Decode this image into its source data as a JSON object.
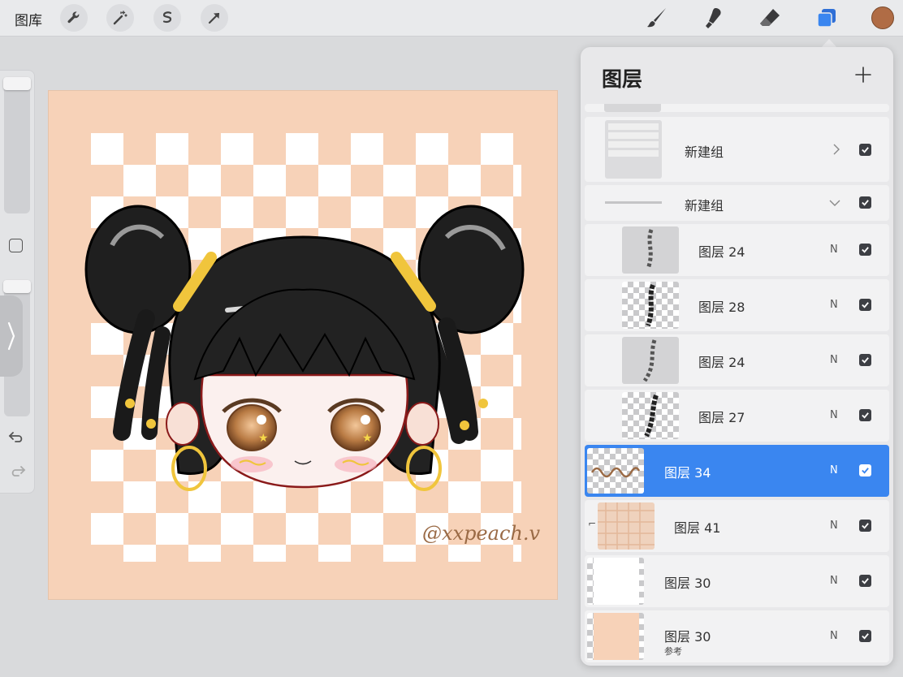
{
  "topbar": {
    "gallery_label": "图库",
    "tools_left": [
      "wrench-icon",
      "magic-wand-icon",
      "selection-icon",
      "transform-arrow-icon"
    ],
    "tools_right": [
      "brush-icon",
      "smudge-icon",
      "eraser-icon",
      "layers-icon"
    ],
    "current_color": "#b06c45",
    "accent": "#3a86f0"
  },
  "canvas": {
    "background_color": "#f7d2b8",
    "signature": "@xxpeach.v"
  },
  "layers_panel": {
    "title": "图层",
    "layers": [
      {
        "name": "新建组",
        "mode": "",
        "kind": "group-collapsed",
        "visible": true
      },
      {
        "name": "新建组",
        "mode": "",
        "kind": "group-expanded",
        "visible": true
      },
      {
        "name": "图层 24",
        "mode": "N",
        "kind": "braid",
        "visible": true
      },
      {
        "name": "图层 28",
        "mode": "N",
        "kind": "braid-dark",
        "visible": true
      },
      {
        "name": "图层 24",
        "mode": "N",
        "kind": "braid",
        "visible": true
      },
      {
        "name": "图层 27",
        "mode": "N",
        "kind": "braid-dark",
        "visible": true
      },
      {
        "name": "图层 34",
        "mode": "N",
        "kind": "signature",
        "visible": true,
        "selected": true
      },
      {
        "name": "图层 41",
        "mode": "N",
        "kind": "pattern",
        "visible": true,
        "clipped": true
      },
      {
        "name": "图层 30",
        "mode": "N",
        "kind": "white",
        "visible": true
      },
      {
        "name": "图层 30",
        "mode": "N",
        "kind": "peach",
        "visible": true,
        "sublabel": "参考"
      }
    ]
  }
}
